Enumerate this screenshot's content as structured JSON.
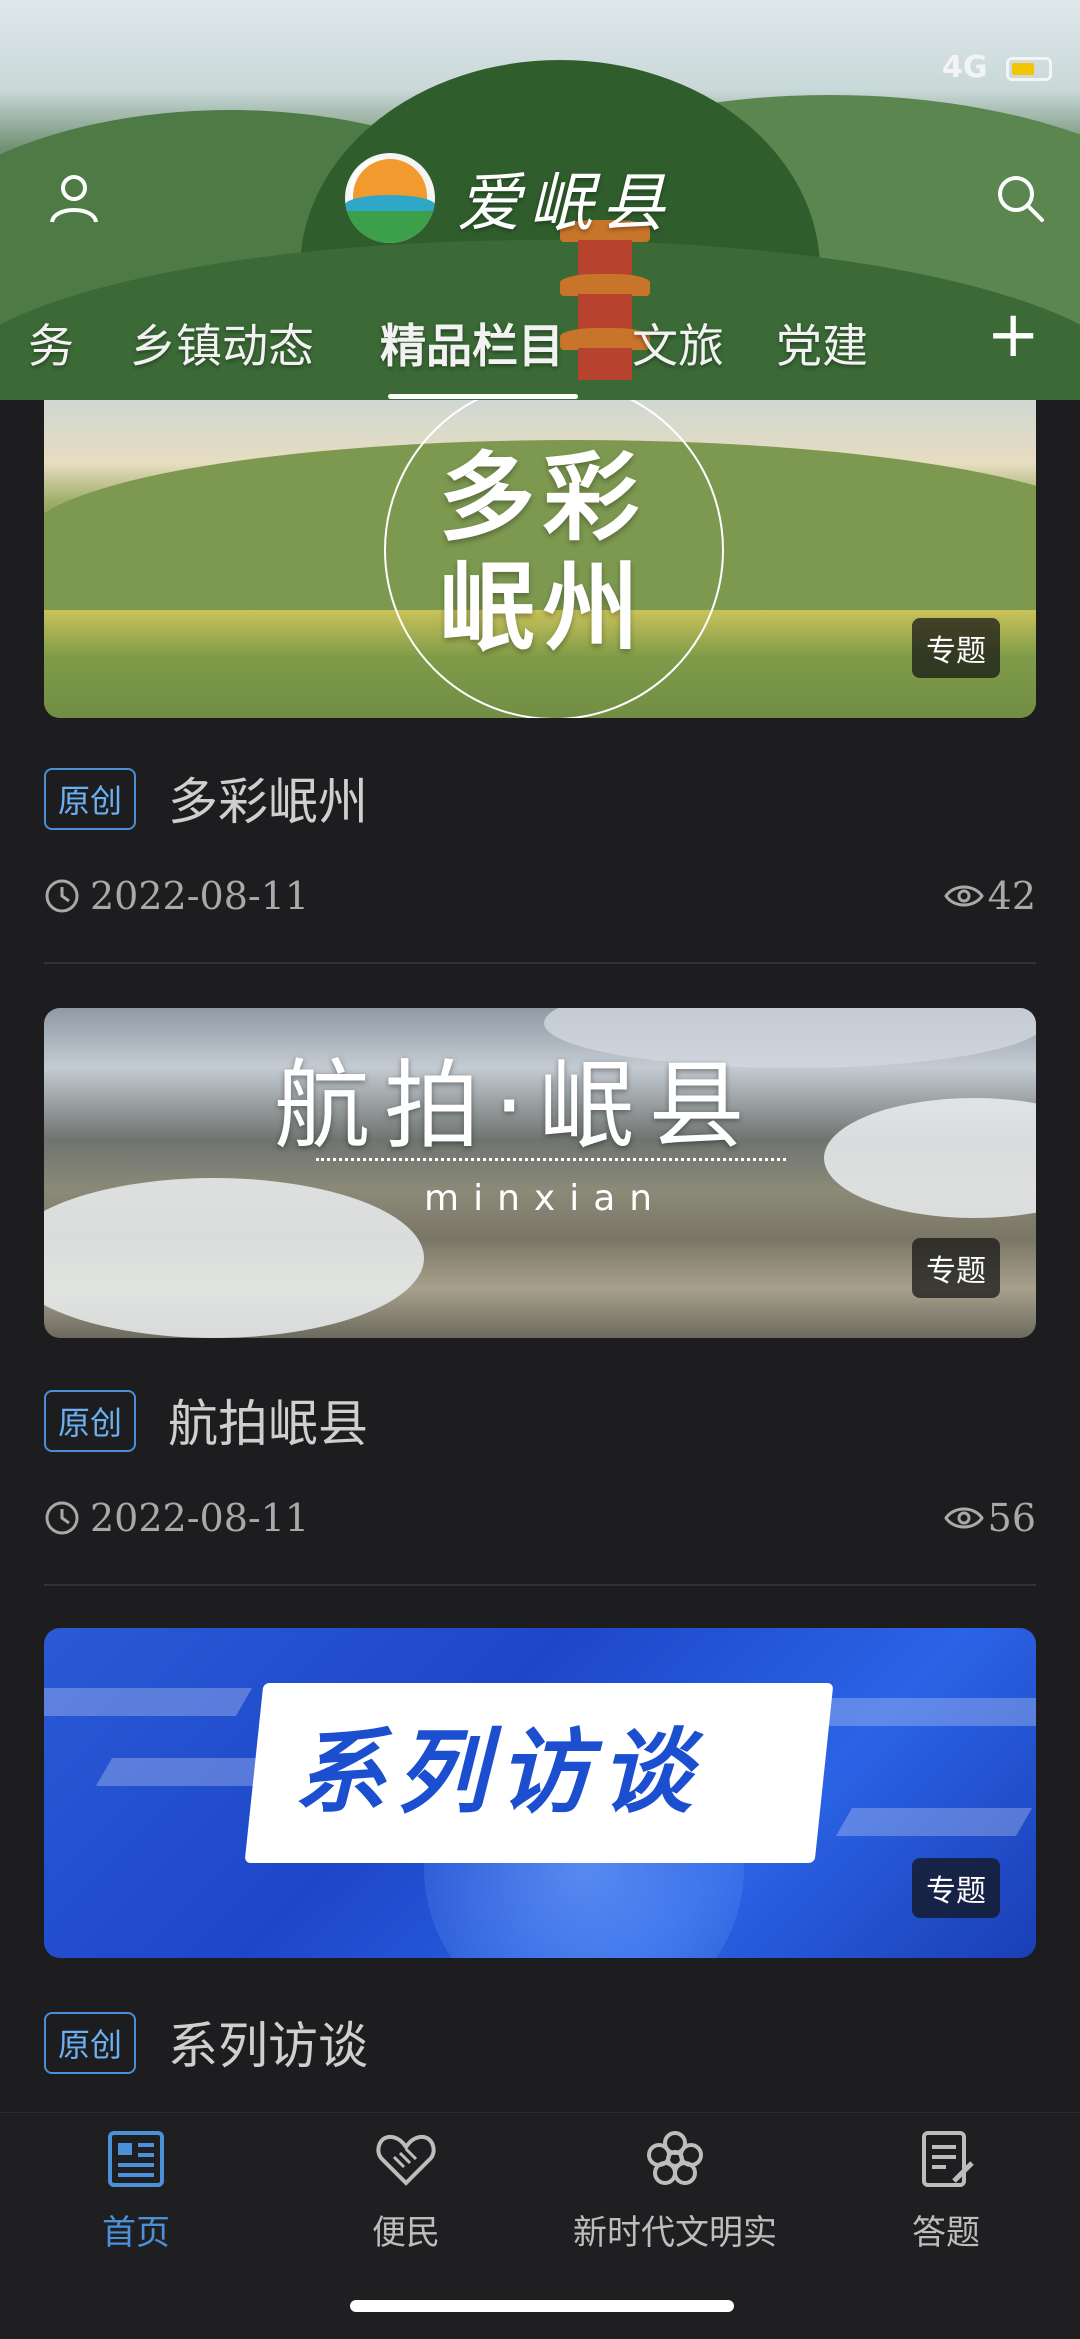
{
  "app": {
    "name": "爱岷县"
  },
  "status_bar": {
    "network": "4G"
  },
  "header": {
    "tabs": [
      {
        "label": "务",
        "active": false
      },
      {
        "label": "乡镇动态",
        "active": false
      },
      {
        "label": "精品栏目",
        "active": true
      },
      {
        "label": "文旅",
        "active": false
      },
      {
        "label": "党建",
        "active": false
      }
    ],
    "add_tab": "+"
  },
  "feed": [
    {
      "image_text": [
        "多彩",
        "岷州"
      ],
      "badge": "专题",
      "tag": "原创",
      "title": "多彩岷州",
      "date": "2022-08-11",
      "views": "42"
    },
    {
      "image_text": [
        "航拍·岷县",
        "minxian"
      ],
      "badge": "专题",
      "tag": "原创",
      "title": "航拍岷县",
      "date": "2022-08-11",
      "views": "56"
    },
    {
      "image_text": [
        "系列访谈"
      ],
      "badge": "专题",
      "tag": "原创",
      "title": "系列访谈"
    }
  ],
  "bottom_nav": [
    {
      "label": "首页",
      "icon": "news-icon",
      "active": true
    },
    {
      "label": "便民",
      "icon": "handshake-heart-icon",
      "active": false
    },
    {
      "label": "新时代文明实",
      "icon": "flower-icon",
      "active": false
    },
    {
      "label": "答题",
      "icon": "quiz-icon",
      "active": false
    }
  ],
  "colors": {
    "accent": "#4c90da",
    "background": "#1d1d1f",
    "tag_border": "#4a8fd6"
  }
}
